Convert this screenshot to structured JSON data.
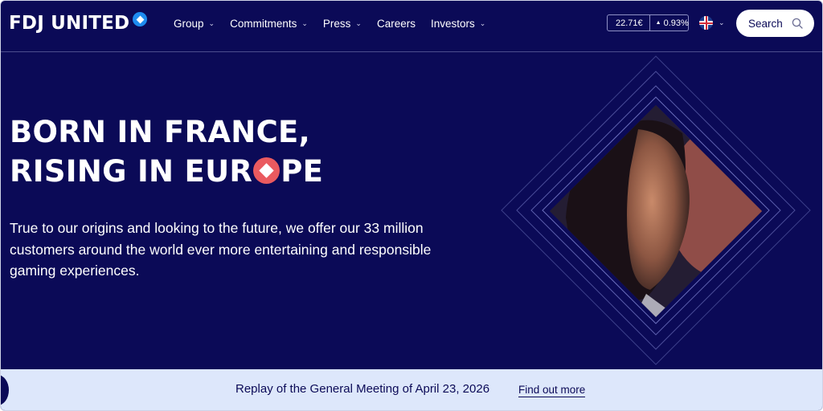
{
  "brand": {
    "name": "FDJ UNITED"
  },
  "nav": {
    "items": [
      {
        "label": "Group",
        "has_menu": true
      },
      {
        "label": "Commitments",
        "has_menu": true
      },
      {
        "label": "Press",
        "has_menu": true
      },
      {
        "label": "Careers",
        "has_menu": false
      },
      {
        "label": "Investors",
        "has_menu": true
      }
    ]
  },
  "stock": {
    "price": "22.71€",
    "change": "0.93%",
    "direction": "up"
  },
  "language": {
    "flag": "uk-flag-icon"
  },
  "search": {
    "label": "Search"
  },
  "hero": {
    "headline_line1": "BORN IN FRANCE,",
    "headline_line2_before": "RISING IN EUR",
    "headline_line2_after": "PE",
    "intro": "True to our origins and looking to the future, we offer our 33 million customers around the world ever more entertaining and responsible gaming experiences."
  },
  "banner": {
    "message": "Replay of the General Meeting of April 23, 2026",
    "link": "Find out more"
  },
  "colors": {
    "background": "#0b0a57",
    "accent_blue": "#1e8cf0",
    "accent_coral": "#ea5a5f",
    "banner": "#dde7fb"
  }
}
